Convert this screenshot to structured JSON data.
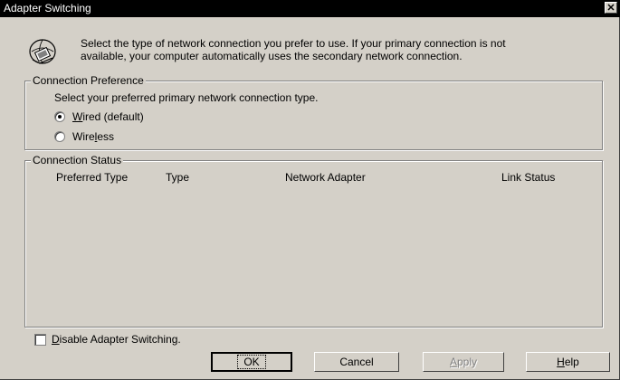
{
  "window": {
    "title": "Adapter Switching",
    "close_glyph": "✕"
  },
  "intro": {
    "icon": "network-connection-icon",
    "line1": "Select the type of network connection you prefer to use. If your primary connection is not",
    "line2": "available, your computer automatically uses the secondary network connection."
  },
  "preference": {
    "group_title": "Connection Preference",
    "description": "Select your preferred primary network connection type.",
    "options": [
      {
        "before": "",
        "accel": "W",
        "after": "ired (default)",
        "checked": true
      },
      {
        "before": "Wire",
        "accel": "l",
        "after": "ess",
        "checked": false
      }
    ]
  },
  "status": {
    "group_title": "Connection Status",
    "columns": [
      "Preferred Type",
      "Type",
      "Network Adapter",
      "Link Status"
    ]
  },
  "disable_switch": {
    "accel": "D",
    "rest": "isable Adapter Switching.",
    "checked": false
  },
  "buttons": {
    "ok": "OK",
    "cancel": "Cancel",
    "apply_accel": "A",
    "apply_rest": "pply",
    "help_accel": "H",
    "help_rest": "elp"
  }
}
